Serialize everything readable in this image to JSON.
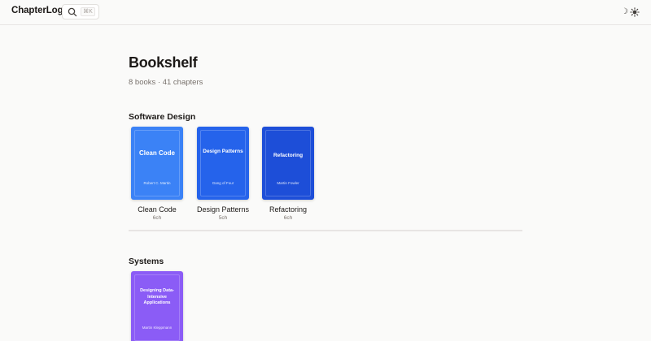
{
  "app": {
    "name": "ChapterLog"
  },
  "search": {
    "shortcut": "⌘K"
  },
  "theme_toggle": {
    "moon": "☽",
    "icons": [
      "moon-icon",
      "sun-icon"
    ]
  },
  "page": {
    "title": "Bookshelf",
    "summary": "8 books · 41 chapters"
  },
  "sections": [
    {
      "title": "Software Design",
      "books": [
        {
          "cover_title": "Clean Code",
          "cover_author": "Robert C. Martin",
          "name": "Clean Code",
          "chapters": "6ch",
          "color": "#3b82f6"
        },
        {
          "cover_title": "Design Patterns",
          "cover_author": "Gang of Four",
          "name": "Design Patterns",
          "chapters": "5ch",
          "color": "#2563eb"
        },
        {
          "cover_title": "Refactoring",
          "cover_author": "Martin Fowler",
          "name": "Refactoring",
          "chapters": "6ch",
          "color": "#1d4ed8"
        }
      ]
    },
    {
      "title": "Systems",
      "books": [
        {
          "cover_title": "Designing Data-Intensive Applications",
          "cover_author": "Martin Kleppmann",
          "name": "",
          "chapters": "",
          "color": "#8b5cf6"
        }
      ]
    }
  ]
}
